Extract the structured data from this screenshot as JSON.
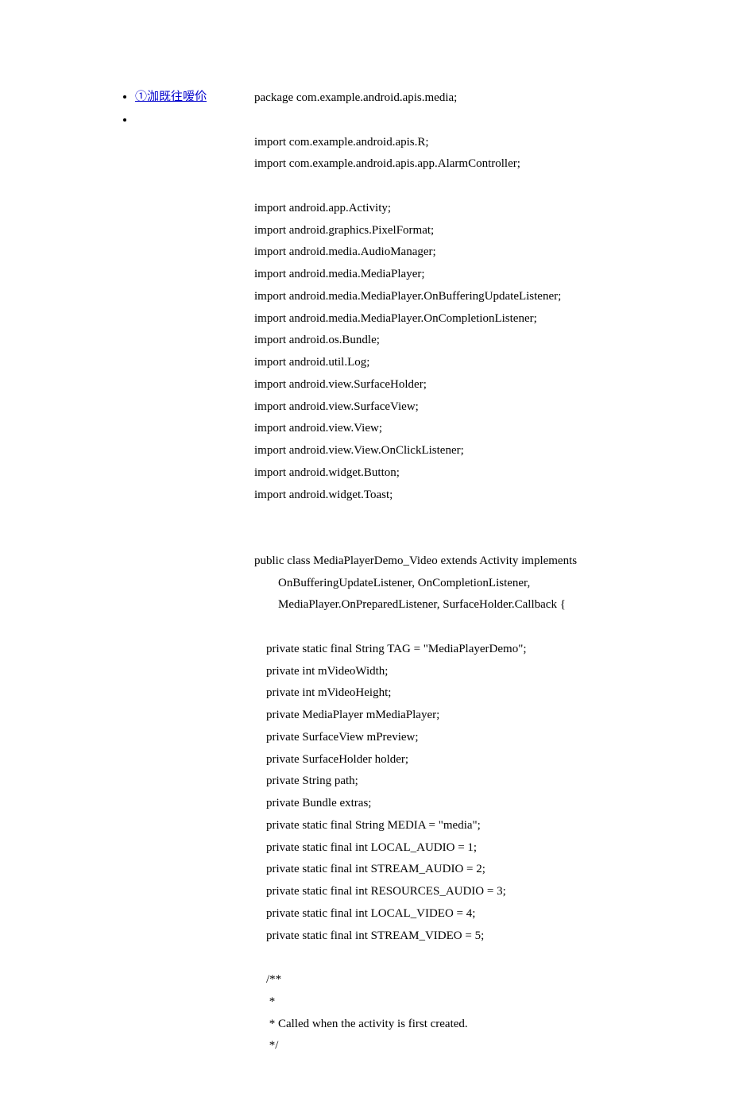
{
  "sidebar": {
    "author_link": "①泇既往嗳伱"
  },
  "code": {
    "line1": "package com.example.android.apis.media;",
    "blank1": "",
    "line2": "import com.example.android.apis.R;",
    "line3": "import com.example.android.apis.app.AlarmController;",
    "blank2": "",
    "line4": "import android.app.Activity;",
    "line5": "import android.graphics.PixelFormat;",
    "line6": "import android.media.AudioManager;",
    "line7": "import android.media.MediaPlayer;",
    "line8": "import android.media.MediaPlayer.OnBufferingUpdateListener;",
    "line9": "import android.media.MediaPlayer.OnCompletionListener;",
    "line10": "import android.os.Bundle;",
    "line11": "import android.util.Log;",
    "line12": "import android.view.SurfaceHolder;",
    "line13": "import android.view.SurfaceView;",
    "line14": "import android.view.View;",
    "line15": "import android.view.View.OnClickListener;",
    "line16": "import android.widget.Button;",
    "line17": "import android.widget.Toast;",
    "blank3": "",
    "blank4": "",
    "line18": "public class MediaPlayerDemo_Video extends Activity implements",
    "line19": "        OnBufferingUpdateListener, OnCompletionListener,",
    "line20": "        MediaPlayer.OnPreparedListener, SurfaceHolder.Callback {",
    "blank5": "",
    "line21": "    private static final String TAG = \"MediaPlayerDemo\";",
    "line22": "    private int mVideoWidth;",
    "line23": "    private int mVideoHeight;",
    "line24": "    private MediaPlayer mMediaPlayer;",
    "line25": "    private SurfaceView mPreview;",
    "line26": "    private SurfaceHolder holder;",
    "line27": "    private String path;",
    "line28": "    private Bundle extras;",
    "line29": "    private static final String MEDIA = \"media\";",
    "line30": "    private static final int LOCAL_AUDIO = 1;",
    "line31": "    private static final int STREAM_AUDIO = 2;",
    "line32": "    private static final int RESOURCES_AUDIO = 3;",
    "line33": "    private static final int LOCAL_VIDEO = 4;",
    "line34": "    private static final int STREAM_VIDEO = 5;",
    "blank6": "",
    "line35": "    /**",
    "line36": "     *",
    "line37": "     * Called when the activity is first created.",
    "line38": "     */"
  }
}
